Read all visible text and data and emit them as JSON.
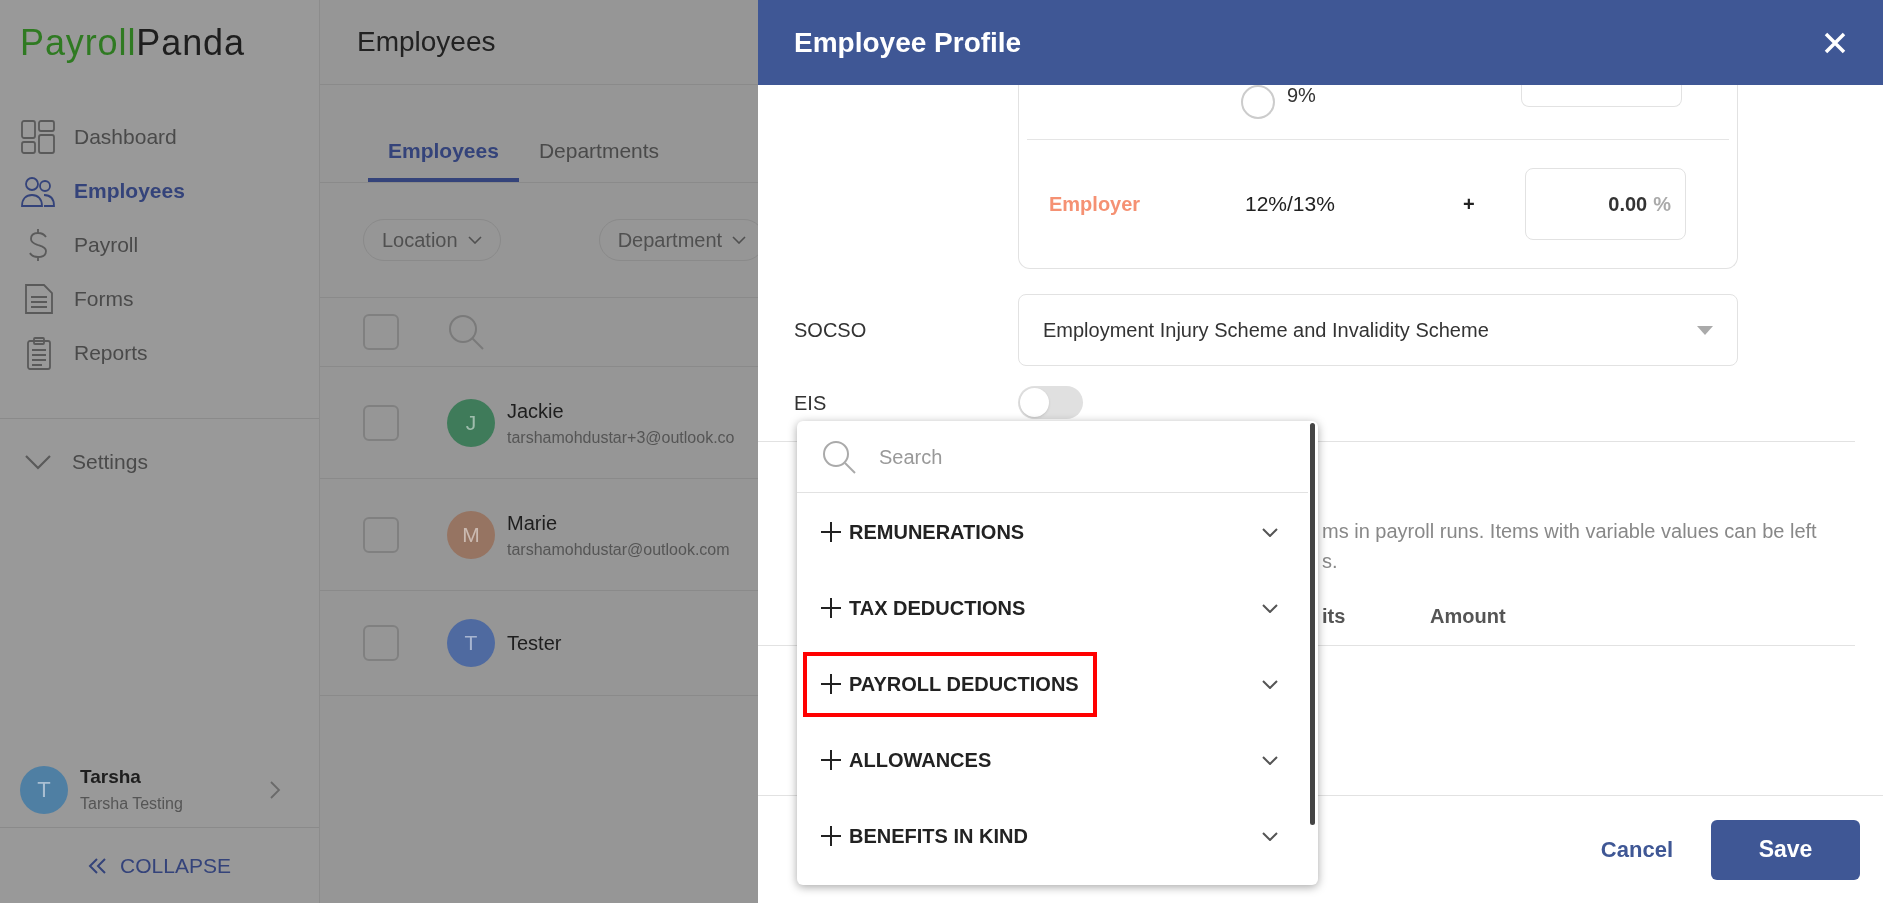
{
  "logo": {
    "part_1": "Payroll",
    "part_2": "Panda"
  },
  "sidebar": {
    "items": [
      {
        "label": "Dashboard",
        "selected": false
      },
      {
        "label": "Employees",
        "selected": true
      },
      {
        "label": "Payroll",
        "selected": false
      },
      {
        "label": "Forms",
        "selected": false
      },
      {
        "label": "Reports",
        "selected": false
      }
    ],
    "settings": {
      "label": "Settings",
      "expanded": false
    },
    "user": {
      "initial": "T",
      "name": "Tarsha",
      "org": "Tarsha Testing",
      "color": "#4f7fa3"
    },
    "collapse": "COLLAPSE"
  },
  "page": {
    "title": "Employees",
    "tabs": [
      {
        "label": "Employees",
        "selected": true
      },
      {
        "label": "Departments",
        "selected": false
      }
    ],
    "filters": [
      "Location",
      "Department"
    ],
    "select_all": {
      "checked": false
    },
    "employees": [
      {
        "initial": "J",
        "name": "Jackie",
        "email": "tarshamohdustar+3@outlook.co",
        "color": "#3f7b5a",
        "checked": false
      },
      {
        "initial": "M",
        "name": "Marie",
        "email": "tarshamohdustar@outlook.com",
        "color": "#967462",
        "checked": false
      },
      {
        "initial": "T",
        "name": "Tester",
        "color": "#4f6aa0",
        "checked": false
      }
    ]
  },
  "panel": {
    "title": "Employee Profile",
    "rate_option": {
      "label": "9%",
      "selected": false
    },
    "employer": {
      "label": "Employer",
      "rate": "12%/13%",
      "operator": "+",
      "value": "0.00",
      "unit": "%"
    },
    "socso": {
      "label": "SOCSO",
      "value": "Employment Injury Scheme and Invalidity Scheme"
    },
    "eis": {
      "label": "EIS",
      "on": false
    },
    "description": "ms in payroll runs. Items with variable values can be left",
    "description_2": "s.",
    "column_3": "its",
    "column_4": "Amount",
    "dropdown": {
      "placeholder": "Search",
      "items": [
        {
          "label": "REMUNERATIONS",
          "highlighted": false
        },
        {
          "label": "TAX DEDUCTIONS",
          "highlighted": false
        },
        {
          "label": "PAYROLL DEDUCTIONS",
          "highlighted": true
        },
        {
          "label": "ALLOWANCES",
          "highlighted": false
        },
        {
          "label": "BENEFITS IN KIND",
          "highlighted": false
        }
      ]
    },
    "footer": {
      "cancel": "Cancel",
      "save": "Save"
    }
  }
}
